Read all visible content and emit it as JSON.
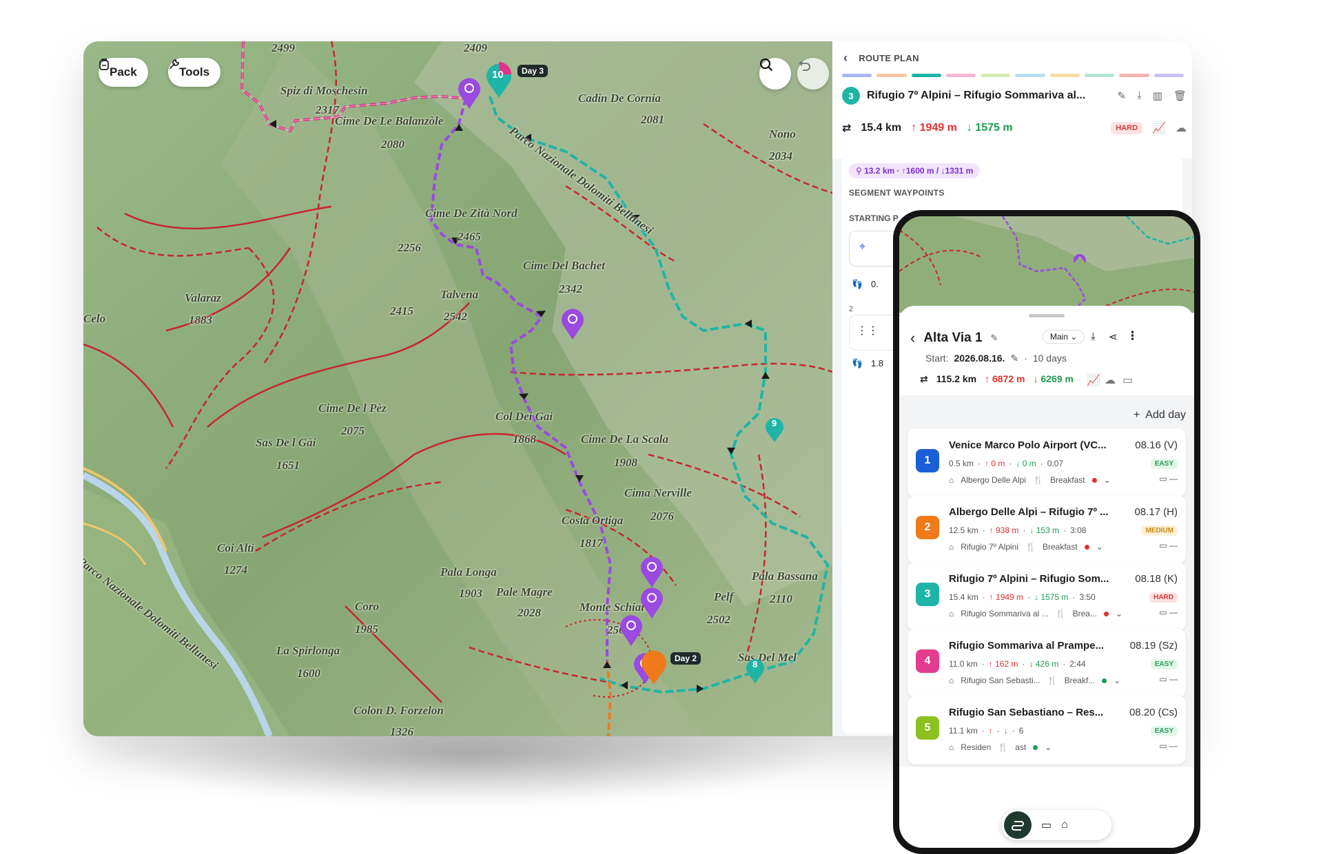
{
  "map": {
    "buttons": {
      "pack": "Pack",
      "tools": "Tools"
    },
    "labels": [
      {
        "text": "Spiz di Moschesin"
      },
      {
        "text": "2317"
      },
      {
        "text": "Cime De Le Balanzòle"
      },
      {
        "text": "2080"
      },
      {
        "text": "Cadin De Cornia"
      },
      {
        "text": "2081"
      },
      {
        "text": "Nono"
      },
      {
        "text": "2034"
      },
      {
        "text": "Parco Nazionale Dolomiti Bellunesi"
      },
      {
        "text": "Cime De Zità Nord"
      },
      {
        "text": "2465"
      },
      {
        "text": "2256"
      },
      {
        "text": "Cime Del Bachet"
      },
      {
        "text": "2342"
      },
      {
        "text": "Talvena"
      },
      {
        "text": "2542"
      },
      {
        "text": "2415"
      },
      {
        "text": "Valaraz"
      },
      {
        "text": "1883"
      },
      {
        "text": "Celo"
      },
      {
        "text": "Cime De l Pèz"
      },
      {
        "text": "2075"
      },
      {
        "text": "Sas De l Gài"
      },
      {
        "text": "1651"
      },
      {
        "text": "Col Dei Gai"
      },
      {
        "text": "1868"
      },
      {
        "text": "Cime De La Scala"
      },
      {
        "text": "1908"
      },
      {
        "text": "Cima Nerville"
      },
      {
        "text": "2076"
      },
      {
        "text": "Costa Ortiga"
      },
      {
        "text": "1817"
      },
      {
        "text": "Coi Alti"
      },
      {
        "text": "1274"
      },
      {
        "text": "Pala Longa"
      },
      {
        "text": "1903"
      },
      {
        "text": "Pale Magre"
      },
      {
        "text": "2028"
      },
      {
        "text": "Monte Schiara"
      },
      {
        "text": "2565"
      },
      {
        "text": "Pelf"
      },
      {
        "text": "2502"
      },
      {
        "text": "Pala Bassana"
      },
      {
        "text": "2110"
      },
      {
        "text": "Coro"
      },
      {
        "text": "1985"
      },
      {
        "text": "La Spirlonga"
      },
      {
        "text": "1600"
      },
      {
        "text": "Sas Del Mel"
      },
      {
        "text": "Colon D. Forzelon"
      },
      {
        "text": "1326"
      },
      {
        "text": "2499"
      },
      {
        "text": "2409"
      },
      {
        "text": "Parco Nazionale Dolomiti Bellunesi"
      }
    ],
    "day_tags": {
      "day3": "Day 3",
      "day2": "Day 2"
    },
    "markers": {
      "m10": "10",
      "m9": "9",
      "m8": "8"
    }
  },
  "panel": {
    "back_label": "ROUTE PLAN",
    "color_segments": [
      "#a7b6f5",
      "#f9c5a5",
      "#1fb5a6",
      "#f5b7d6",
      "#d6ecb3",
      "#b5e1f1",
      "#f9dca5",
      "#b3e6d6",
      "#f5b3b3",
      "#c9c0f0"
    ],
    "segment_number": "3",
    "title": "Rifugio 7º Alpini – Rifugio Sommariva al...",
    "distance": "15.4 km",
    "ascent": "1949 m",
    "descent": "1575 m",
    "difficulty": "HARD",
    "segment_stats": {
      "distance": "13.2 km",
      "sep": "·",
      "ascent": "1600 m",
      "slash": "/",
      "descent": "1331 m"
    },
    "segment_waypoints_title": "SEGMENT WAYPOINTS",
    "starting_label": "STARTING P",
    "row_values": {
      "v1": "0.",
      "num2": "2",
      "v2": "1.8"
    }
  },
  "phone": {
    "route_name": "Alta Via 1",
    "plan_label": "Main",
    "start_label": "Start:",
    "start_date": "2026.08.16.",
    "days": "10 days",
    "sep": "·",
    "distance": "115.2 km",
    "ascent": "6872 m",
    "descent": "6269 m",
    "add_day": "Add day",
    "day_cards": [
      {
        "num": "1",
        "color": "#1a5fd8",
        "title": "Venice Marco Polo Airport (VC...",
        "date": "08.16 (V)",
        "km": "0.5 km",
        "up": "0 m",
        "down": "0 m",
        "time": "0:07",
        "diff": "EASY",
        "diff_class": "easy",
        "stay": "Albergo Delle Alpi",
        "meal": "Breakfast",
        "dot": "#e03131"
      },
      {
        "num": "2",
        "color": "#f07a1a",
        "title": "Albergo Delle Alpi – Rifugio 7º ...",
        "date": "08.17 (H)",
        "km": "12.5 km",
        "up": "938 m",
        "down": "153 m",
        "time": "3:08",
        "diff": "MEDIUM",
        "diff_class": "medium",
        "stay": "Rifugio 7º Alpini",
        "meal": "Breakfast",
        "dot": "#e03131"
      },
      {
        "num": "3",
        "color": "#1fb5a6",
        "title": "Rifugio 7º Alpini – Rifugio Som...",
        "date": "08.18 (K)",
        "km": "15.4 km",
        "up": "1949 m",
        "down": "1575 m",
        "time": "3:50",
        "diff": "HARD",
        "diff_class": "hard",
        "stay": "Rifugio Sommariva al ...",
        "meal": "Brea...",
        "dot": "#e03131"
      },
      {
        "num": "4",
        "color": "#e43c8e",
        "title": "Rifugio Sommariva al Prampe...",
        "date": "08.19 (Sz)",
        "km": "11.0 km",
        "up": "162 m",
        "down": "426 m",
        "time": "2:44",
        "diff": "EASY",
        "diff_class": "easy",
        "stay": "Rifugio San Sebasti...",
        "meal": "Breakf...",
        "dot": "#1d9b52"
      },
      {
        "num": "5",
        "color": "#8cc21f",
        "title": "Rifugio San Sebastiano – Res...",
        "date": "08.20 (Cs)",
        "km": "11.1 km",
        "up": "",
        "down": "",
        "time": "6",
        "diff": "EASY",
        "diff_class": "easy",
        "stay": "Residen",
        "meal": "ast",
        "dot": "#1d9b52"
      }
    ]
  }
}
